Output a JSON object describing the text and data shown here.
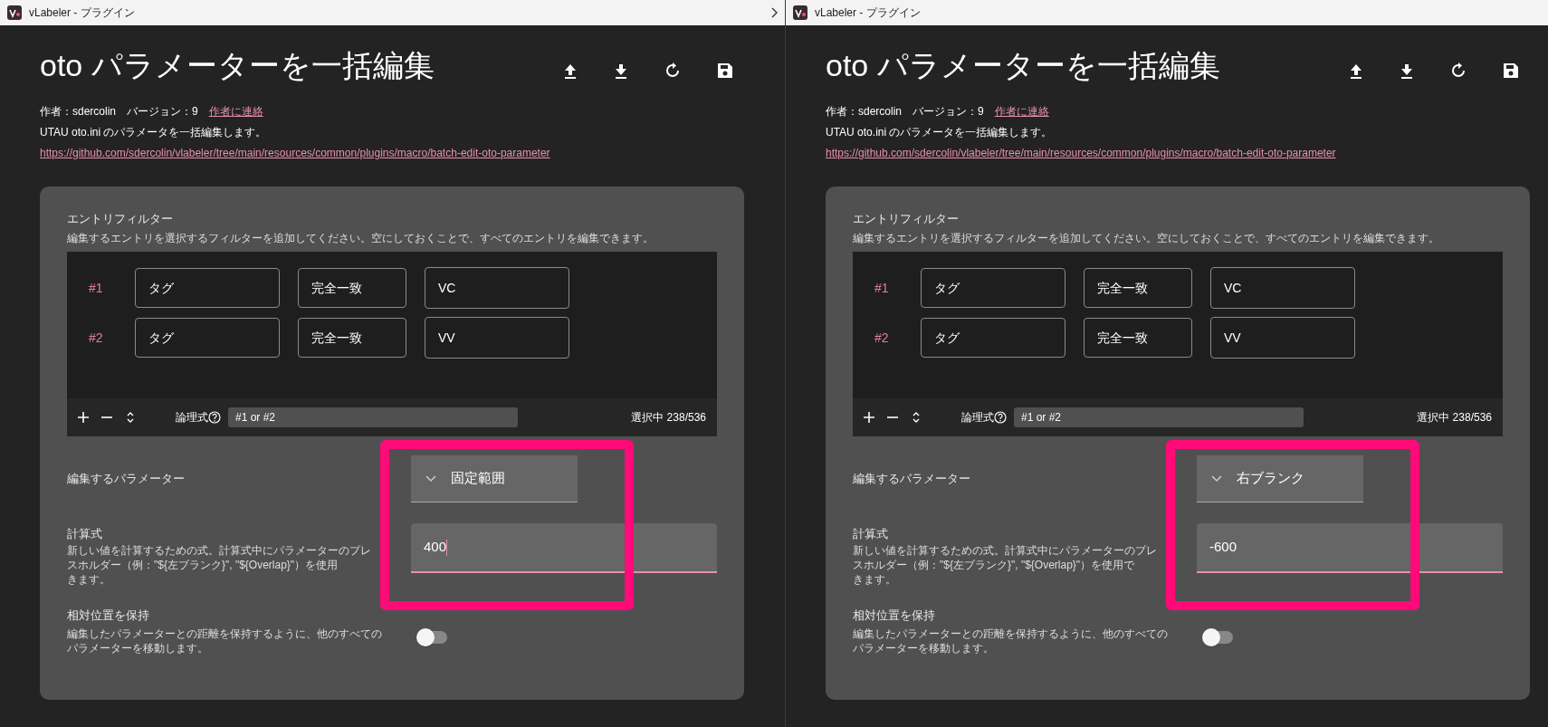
{
  "panels": [
    {
      "window_title": "vLabeler - プラグイン",
      "title": "oto パラメーターを一括編集",
      "author": "作者：sdercolin",
      "version": "バージョン：9",
      "contact_link": "作者に連絡",
      "description": "UTAU oto.ini のパラメータを一括編集します。",
      "url": "https://github.com/sdercolin/vlabeler/tree/main/resources/common/plugins/macro/batch-edit-oto-parameter",
      "filter": {
        "label": "エントリフィルター",
        "description": "編集するエントリを選択するフィルターを追加してください。空にしておくことで、すべてのエントリを編集できます。",
        "rows": [
          {
            "index": "#1",
            "field": "タグ",
            "match": "完全一致",
            "value": "VC"
          },
          {
            "index": "#2",
            "field": "タグ",
            "match": "完全一致",
            "value": "VV"
          }
        ],
        "logic_label": "論理式",
        "logic_value": "#1 or #2",
        "selection": "選択中 238/536"
      },
      "parameter": {
        "label": "編集するパラメーター",
        "value": "固定範囲"
      },
      "formula": {
        "label": "計算式",
        "description_lines": [
          "新しい値を計算するための式。計算式中にパラメーターのプレ",
          "スホルダー（例：\"${左ブランク}\", \"${Overlap}\"）を使用",
          "きます。"
        ],
        "value": "400",
        "cursor": true
      },
      "keep_relative": {
        "label": "相対位置を保持",
        "description_lines": [
          "編集したパラメーターとの距離を保持するように、他のすべての",
          "パラメーターを移動します。"
        ],
        "on": false
      },
      "highlight": true
    },
    {
      "window_title": "vLabeler - プラグイン",
      "title": "oto パラメーターを一括編集",
      "author": "作者：sdercolin",
      "version": "バージョン：9",
      "contact_link": "作者に連絡",
      "description": "UTAU oto.ini のパラメータを一括編集します。",
      "url": "https://github.com/sdercolin/vlabeler/tree/main/resources/common/plugins/macro/batch-edit-oto-parameter",
      "filter": {
        "label": "エントリフィルター",
        "description": "編集するエントリを選択するフィルターを追加してください。空にしておくことで、すべてのエントリを編集できます。",
        "rows": [
          {
            "index": "#1",
            "field": "タグ",
            "match": "完全一致",
            "value": "VC"
          },
          {
            "index": "#2",
            "field": "タグ",
            "match": "完全一致",
            "value": "VV"
          }
        ],
        "logic_label": "論理式",
        "logic_value": "#1 or #2",
        "selection": "選択中 238/536"
      },
      "parameter": {
        "label": "編集するパラメーター",
        "value": "右ブランク"
      },
      "formula": {
        "label": "計算式",
        "description_lines": [
          "新しい値を計算するための式。計算式中にパラメーターのプレ",
          "スホルダー（例：\"${左ブランク}\", \"${Overlap}\"）を使用で",
          "きます。"
        ],
        "value": "-600",
        "cursor": false
      },
      "keep_relative": {
        "label": "相対位置を保持",
        "description_lines": [
          "編集したパラメーターとの距離を保持するように、他のすべての",
          "パラメーターを移動します。"
        ],
        "on": false
      },
      "highlight": true
    }
  ]
}
